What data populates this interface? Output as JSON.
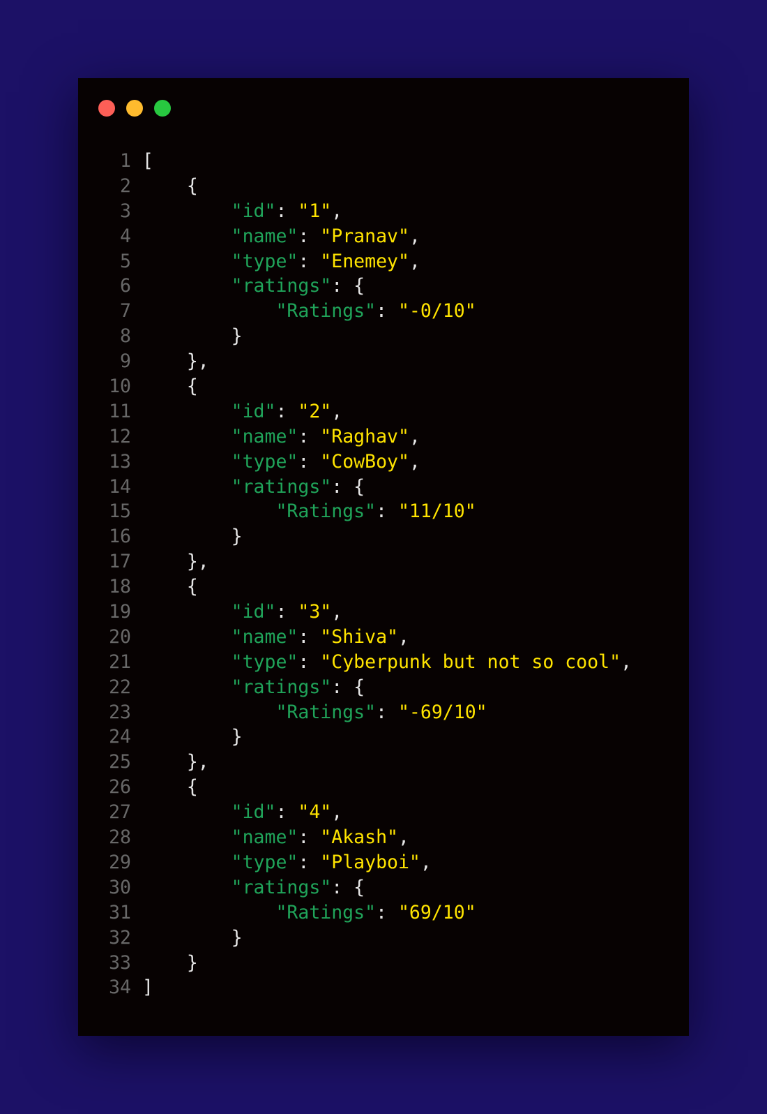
{
  "window_controls": {
    "close_color": "#fd5f57",
    "minimize_color": "#febb2e",
    "maximize_color": "#28c840"
  },
  "colors": {
    "background": "#1c1166",
    "editor": "#070202",
    "key": "#20a45a",
    "string": "#ffe400",
    "punctuation": "#e6e6e6",
    "line_number": "#686868"
  },
  "code_lines": [
    {
      "n": "1",
      "tokens": [
        {
          "t": "p",
          "v": "["
        }
      ]
    },
    {
      "n": "2",
      "tokens": [
        {
          "t": "p",
          "v": "    {"
        }
      ]
    },
    {
      "n": "3",
      "tokens": [
        {
          "t": "p",
          "v": "        "
        },
        {
          "t": "k",
          "v": "\"id\""
        },
        {
          "t": "p",
          "v": ": "
        },
        {
          "t": "s",
          "v": "\"1\""
        },
        {
          "t": "p",
          "v": ","
        }
      ]
    },
    {
      "n": "4",
      "tokens": [
        {
          "t": "p",
          "v": "        "
        },
        {
          "t": "k",
          "v": "\"name\""
        },
        {
          "t": "p",
          "v": ": "
        },
        {
          "t": "s",
          "v": "\"Pranav\""
        },
        {
          "t": "p",
          "v": ","
        }
      ]
    },
    {
      "n": "5",
      "tokens": [
        {
          "t": "p",
          "v": "        "
        },
        {
          "t": "k",
          "v": "\"type\""
        },
        {
          "t": "p",
          "v": ": "
        },
        {
          "t": "s",
          "v": "\"Enemey\""
        },
        {
          "t": "p",
          "v": ","
        }
      ]
    },
    {
      "n": "6",
      "tokens": [
        {
          "t": "p",
          "v": "        "
        },
        {
          "t": "k",
          "v": "\"ratings\""
        },
        {
          "t": "p",
          "v": ": {"
        }
      ]
    },
    {
      "n": "7",
      "tokens": [
        {
          "t": "p",
          "v": "            "
        },
        {
          "t": "k",
          "v": "\"Ratings\""
        },
        {
          "t": "p",
          "v": ": "
        },
        {
          "t": "s",
          "v": "\"-0/10\""
        }
      ]
    },
    {
      "n": "8",
      "tokens": [
        {
          "t": "p",
          "v": "        }"
        }
      ]
    },
    {
      "n": "9",
      "tokens": [
        {
          "t": "p",
          "v": "    },"
        }
      ]
    },
    {
      "n": "10",
      "tokens": [
        {
          "t": "p",
          "v": "    {"
        }
      ]
    },
    {
      "n": "11",
      "tokens": [
        {
          "t": "p",
          "v": "        "
        },
        {
          "t": "k",
          "v": "\"id\""
        },
        {
          "t": "p",
          "v": ": "
        },
        {
          "t": "s",
          "v": "\"2\""
        },
        {
          "t": "p",
          "v": ","
        }
      ]
    },
    {
      "n": "12",
      "tokens": [
        {
          "t": "p",
          "v": "        "
        },
        {
          "t": "k",
          "v": "\"name\""
        },
        {
          "t": "p",
          "v": ": "
        },
        {
          "t": "s",
          "v": "\"Raghav\""
        },
        {
          "t": "p",
          "v": ","
        }
      ]
    },
    {
      "n": "13",
      "tokens": [
        {
          "t": "p",
          "v": "        "
        },
        {
          "t": "k",
          "v": "\"type\""
        },
        {
          "t": "p",
          "v": ": "
        },
        {
          "t": "s",
          "v": "\"CowBoy\""
        },
        {
          "t": "p",
          "v": ","
        }
      ]
    },
    {
      "n": "14",
      "tokens": [
        {
          "t": "p",
          "v": "        "
        },
        {
          "t": "k",
          "v": "\"ratings\""
        },
        {
          "t": "p",
          "v": ": {"
        }
      ]
    },
    {
      "n": "15",
      "tokens": [
        {
          "t": "p",
          "v": "            "
        },
        {
          "t": "k",
          "v": "\"Ratings\""
        },
        {
          "t": "p",
          "v": ": "
        },
        {
          "t": "s",
          "v": "\"11/10\""
        }
      ]
    },
    {
      "n": "16",
      "tokens": [
        {
          "t": "p",
          "v": "        }"
        }
      ]
    },
    {
      "n": "17",
      "tokens": [
        {
          "t": "p",
          "v": "    },"
        }
      ]
    },
    {
      "n": "18",
      "tokens": [
        {
          "t": "p",
          "v": "    {"
        }
      ]
    },
    {
      "n": "19",
      "tokens": [
        {
          "t": "p",
          "v": "        "
        },
        {
          "t": "k",
          "v": "\"id\""
        },
        {
          "t": "p",
          "v": ": "
        },
        {
          "t": "s",
          "v": "\"3\""
        },
        {
          "t": "p",
          "v": ","
        }
      ]
    },
    {
      "n": "20",
      "tokens": [
        {
          "t": "p",
          "v": "        "
        },
        {
          "t": "k",
          "v": "\"name\""
        },
        {
          "t": "p",
          "v": ": "
        },
        {
          "t": "s",
          "v": "\"Shiva\""
        },
        {
          "t": "p",
          "v": ","
        }
      ]
    },
    {
      "n": "21",
      "tokens": [
        {
          "t": "p",
          "v": "        "
        },
        {
          "t": "k",
          "v": "\"type\""
        },
        {
          "t": "p",
          "v": ": "
        },
        {
          "t": "s",
          "v": "\"Cyberpunk but not so cool\""
        },
        {
          "t": "p",
          "v": ","
        }
      ]
    },
    {
      "n": "22",
      "tokens": [
        {
          "t": "p",
          "v": "        "
        },
        {
          "t": "k",
          "v": "\"ratings\""
        },
        {
          "t": "p",
          "v": ": {"
        }
      ]
    },
    {
      "n": "23",
      "tokens": [
        {
          "t": "p",
          "v": "            "
        },
        {
          "t": "k",
          "v": "\"Ratings\""
        },
        {
          "t": "p",
          "v": ": "
        },
        {
          "t": "s",
          "v": "\"-69/10\""
        }
      ]
    },
    {
      "n": "24",
      "tokens": [
        {
          "t": "p",
          "v": "        }"
        }
      ]
    },
    {
      "n": "25",
      "tokens": [
        {
          "t": "p",
          "v": "    },"
        }
      ]
    },
    {
      "n": "26",
      "tokens": [
        {
          "t": "p",
          "v": "    {"
        }
      ]
    },
    {
      "n": "27",
      "tokens": [
        {
          "t": "p",
          "v": "        "
        },
        {
          "t": "k",
          "v": "\"id\""
        },
        {
          "t": "p",
          "v": ": "
        },
        {
          "t": "s",
          "v": "\"4\""
        },
        {
          "t": "p",
          "v": ","
        }
      ]
    },
    {
      "n": "28",
      "tokens": [
        {
          "t": "p",
          "v": "        "
        },
        {
          "t": "k",
          "v": "\"name\""
        },
        {
          "t": "p",
          "v": ": "
        },
        {
          "t": "s",
          "v": "\"Akash\""
        },
        {
          "t": "p",
          "v": ","
        }
      ]
    },
    {
      "n": "29",
      "tokens": [
        {
          "t": "p",
          "v": "        "
        },
        {
          "t": "k",
          "v": "\"type\""
        },
        {
          "t": "p",
          "v": ": "
        },
        {
          "t": "s",
          "v": "\"Playboi\""
        },
        {
          "t": "p",
          "v": ","
        }
      ]
    },
    {
      "n": "30",
      "tokens": [
        {
          "t": "p",
          "v": "        "
        },
        {
          "t": "k",
          "v": "\"ratings\""
        },
        {
          "t": "p",
          "v": ": {"
        }
      ]
    },
    {
      "n": "31",
      "tokens": [
        {
          "t": "p",
          "v": "            "
        },
        {
          "t": "k",
          "v": "\"Ratings\""
        },
        {
          "t": "p",
          "v": ": "
        },
        {
          "t": "s",
          "v": "\"69/10\""
        }
      ]
    },
    {
      "n": "32",
      "tokens": [
        {
          "t": "p",
          "v": "        }"
        }
      ]
    },
    {
      "n": "33",
      "tokens": [
        {
          "t": "p",
          "v": "    }"
        }
      ]
    },
    {
      "n": "34",
      "tokens": [
        {
          "t": "p",
          "v": "]"
        }
      ]
    }
  ]
}
